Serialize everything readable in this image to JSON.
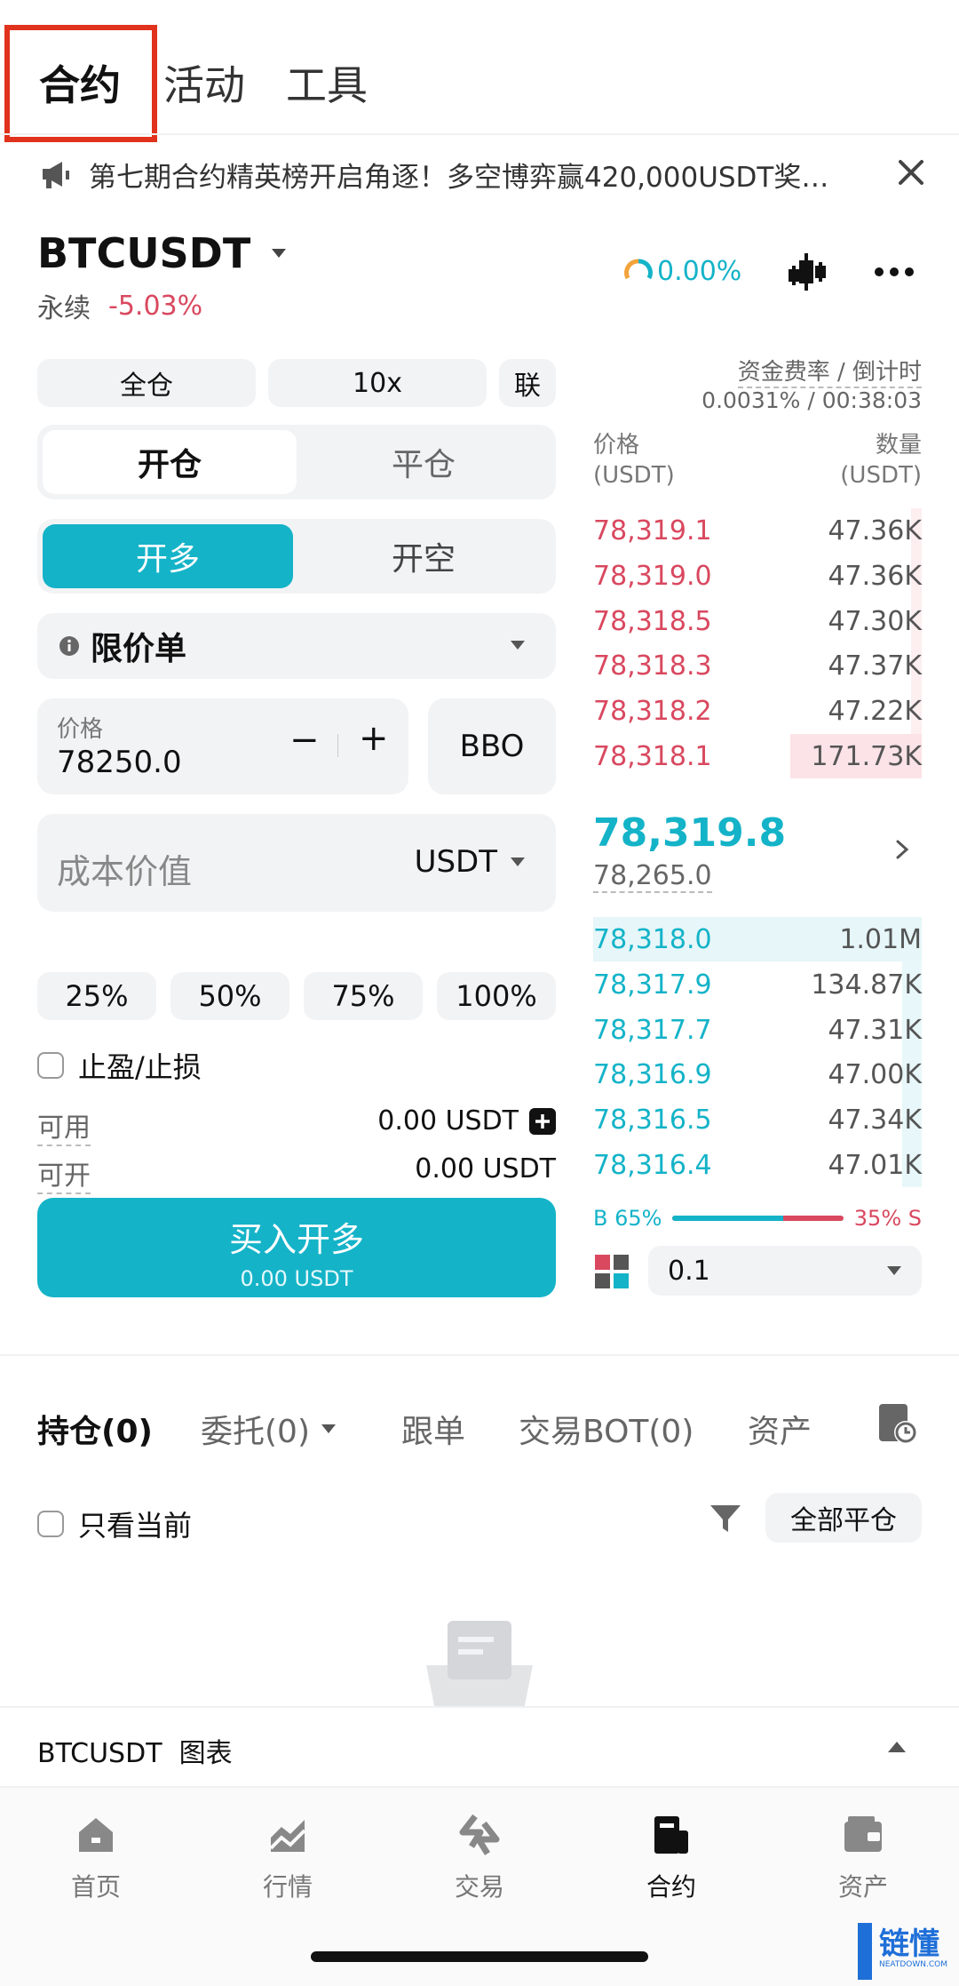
{
  "top_tabs": [
    "合约",
    "活动",
    "工具"
  ],
  "banner": {
    "text": "第七期合约精英榜开启角逐！多空博弈赢420,000USDT奖…"
  },
  "ticker": {
    "symbol": "BTCUSDT",
    "type": "永续",
    "change": "-5.03%",
    "funding_indicator": "0.00%"
  },
  "margin": {
    "mode": "全仓",
    "leverage": "10x",
    "link": "联"
  },
  "open_close_tabs": {
    "open": "开仓",
    "close": "平仓"
  },
  "side_tabs": {
    "long": "开多",
    "short": "开空"
  },
  "order_type": "限价单",
  "price_input": {
    "label": "价格",
    "value": "78250.0",
    "minus": "−",
    "plus": "+",
    "bbo": "BBO"
  },
  "cost_input": {
    "placeholder": "成本价值",
    "unit": "USDT"
  },
  "percent_buttons": [
    "25%",
    "50%",
    "75%",
    "100%"
  ],
  "tp_sl_label": "止盈/止损",
  "available": {
    "label": "可用",
    "value": "0.00 USDT"
  },
  "openable": {
    "label": "可开",
    "value": "0.00 USDT"
  },
  "buy_button": {
    "label": "买入开多",
    "sub": "0.00 USDT"
  },
  "funding": {
    "label": "资金费率 / 倒计时",
    "value": "0.0031% / 00:38:03"
  },
  "orderbook": {
    "price_header": "价格",
    "price_unit": "(USDT)",
    "qty_header": "数量",
    "qty_unit": "(USDT)",
    "asks": [
      {
        "price": "78,319.1",
        "qty": "47.36K",
        "depth": 0.0
      },
      {
        "price": "78,319.0",
        "qty": "47.36K",
        "depth": 0.0
      },
      {
        "price": "78,318.5",
        "qty": "47.30K",
        "depth": 0.0
      },
      {
        "price": "78,318.3",
        "qty": "47.37K",
        "depth": 0.0
      },
      {
        "price": "78,318.2",
        "qty": "47.22K",
        "depth": 0.0
      },
      {
        "price": "78,318.1",
        "qty": "171.73K",
        "depth": 0.4
      }
    ],
    "last_price": "78,319.8",
    "mark_price": "78,265.0",
    "bids": [
      {
        "price": "78,318.0",
        "qty": "1.01M",
        "depth": 1.0
      },
      {
        "price": "78,317.9",
        "qty": "134.87K",
        "depth": 0.0
      },
      {
        "price": "78,317.7",
        "qty": "47.31K",
        "depth": 0.0
      },
      {
        "price": "78,316.9",
        "qty": "47.00K",
        "depth": 0.0
      },
      {
        "price": "78,316.5",
        "qty": "47.34K",
        "depth": 0.0
      },
      {
        "price": "78,316.4",
        "qty": "47.01K",
        "depth": 0.0
      }
    ],
    "buy_ratio_label": "B 65%",
    "sell_ratio_label": "35% S",
    "buy_ratio": 65,
    "precision": "0.1"
  },
  "position_tabs": [
    "持仓(0)",
    "委托(0)",
    "跟单",
    "交易BOT(0)",
    "资产"
  ],
  "only_current_label": "只看当前",
  "close_all_button": "全部平仓",
  "chart_bar_label": "BTCUSDT  图表",
  "bottom_nav": [
    "首页",
    "行情",
    "交易",
    "合约",
    "资产"
  ],
  "watermark": {
    "text": "链懂",
    "sub": "NEATDOWN.COM"
  },
  "colors": {
    "accent": "#14b3c8",
    "sell": "#d9485f",
    "highlight_box": "#e0321c"
  }
}
